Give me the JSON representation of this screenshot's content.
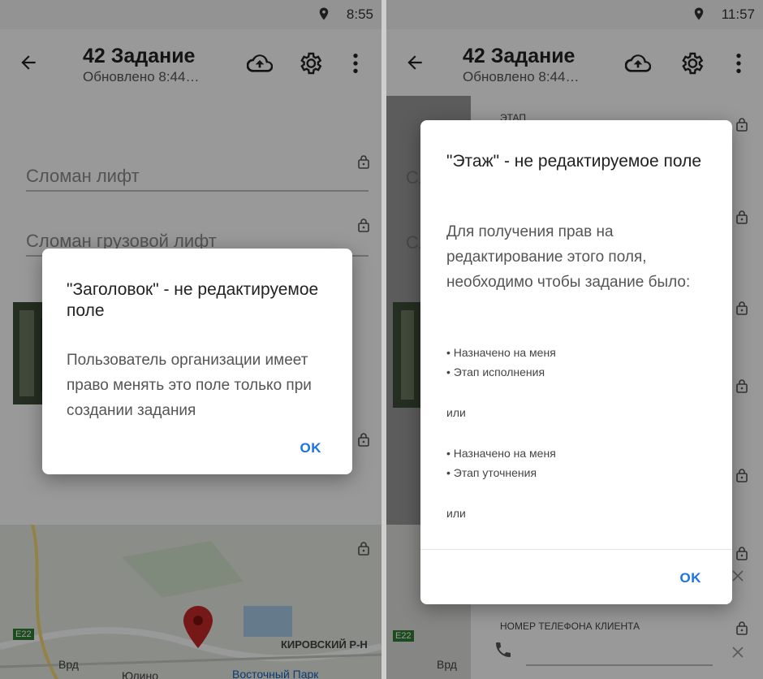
{
  "status_left": {
    "time": "8:55"
  },
  "status_right": {
    "time": "11:57"
  },
  "appbar": {
    "title": "42 Задание",
    "subtitle": "Обновлено 8:44…"
  },
  "left_screen": {
    "fields": [
      "Сломан лифт",
      "Сломан грузовой лифт"
    ],
    "dialog": {
      "title": "\"Заголовок\" - не редактируемое поле",
      "message": "Пользователь организации имеет право менять это поле только при создании задания",
      "ok": "OK"
    },
    "map": {
      "road_badge": "E22",
      "labels": [
        "Врд",
        "Юлино",
        "Восточный Парк",
        "КИРОВСКИЙ Р-Н"
      ]
    }
  },
  "right_screen": {
    "top_label": "ЭТАП",
    "bottom_label": "НОМЕР ТЕЛЕФОНА КЛИЕНТА",
    "left_peek": [
      "Сл",
      "Сл"
    ],
    "map": {
      "road_badge": "E22",
      "label": "Врд"
    },
    "dialog": {
      "title": "\"Этаж\" - не редактируемое поле",
      "message": "Для получения прав на редактирование этого поля, необходимо чтобы задание было:",
      "group1": [
        "• Назначено на меня",
        "• Этап исполнения"
      ],
      "or1": "или",
      "group2": [
        "• Назначено на меня",
        "• Этап уточнения"
      ],
      "or2": "или",
      "ok": "OK"
    }
  },
  "colors": {
    "accent": "#1a73e8",
    "marker": "#c62828"
  }
}
